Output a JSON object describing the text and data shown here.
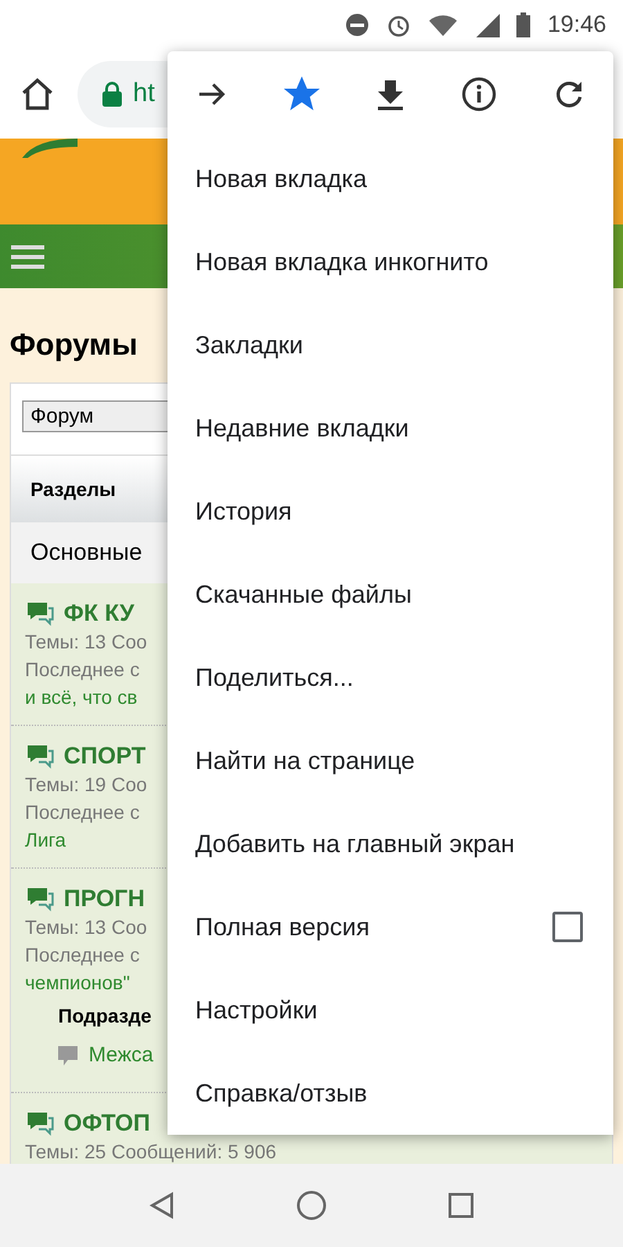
{
  "status_bar": {
    "time": "19:46"
  },
  "toolbar": {
    "url": "ht"
  },
  "page": {
    "heading": "Форумы",
    "select": "Форум",
    "header": "Разделы",
    "category": "Основные",
    "forums": [
      {
        "title": "ФК КУ",
        "stats": "Темы: 13 Соо",
        "last": "Последнее с",
        "link": "и всё, что св"
      },
      {
        "title": "СПОРТ",
        "stats": "Темы: 19 Соо",
        "last": "Последнее с",
        "link": "Лига"
      },
      {
        "title": "ПРОГН",
        "stats": "Темы: 13 Соо",
        "last": "Последнее с",
        "link": "чемпионов\"",
        "sub_label": "Подразде",
        "sub_items": [
          "Межса"
        ]
      },
      {
        "title": "ОФТОП",
        "stats": "Темы: 25 Сообщений: 5 906"
      }
    ]
  },
  "menu": {
    "items": [
      {
        "label": "Новая вкладка"
      },
      {
        "label": "Новая вкладка инкогнито"
      },
      {
        "label": "Закладки"
      },
      {
        "label": "Недавние вкладки"
      },
      {
        "label": "История"
      },
      {
        "label": "Скачанные файлы"
      },
      {
        "label": "Поделиться..."
      },
      {
        "label": "Найти на странице"
      },
      {
        "label": "Добавить на главный экран"
      },
      {
        "label": "Полная версия",
        "kind": "checkbox",
        "checked": false
      },
      {
        "label": "Настройки"
      },
      {
        "label": "Справка/отзыв"
      }
    ],
    "bookmarked": true
  }
}
